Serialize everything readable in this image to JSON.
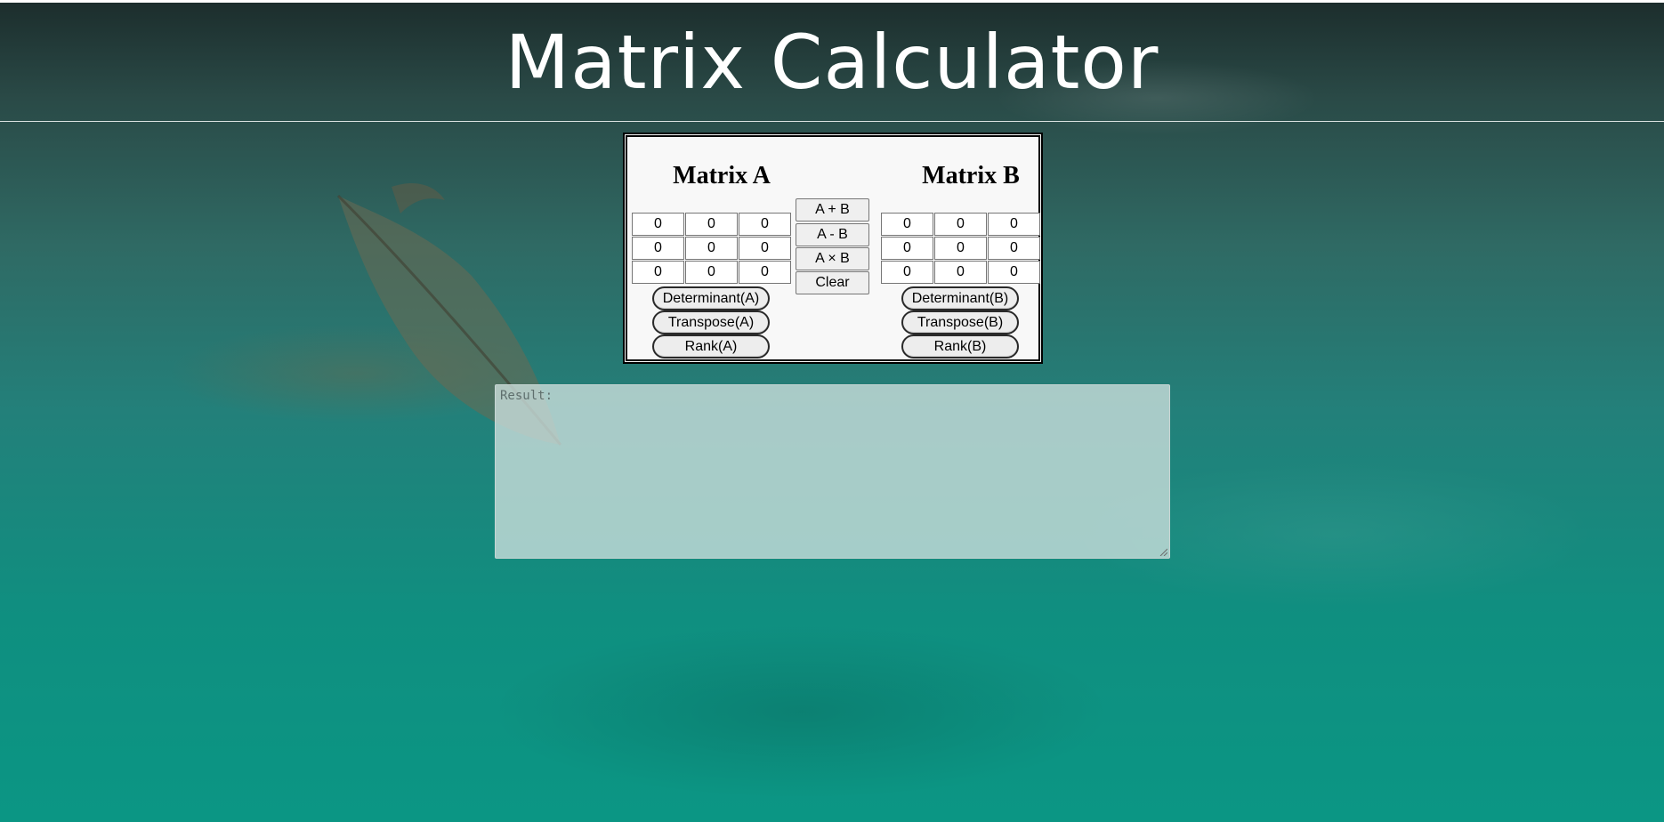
{
  "app_title": "Matrix Calculator",
  "matrix_a": {
    "title": "Matrix A",
    "cells": [
      [
        "0",
        "0",
        "0"
      ],
      [
        "0",
        "0",
        "0"
      ],
      [
        "0",
        "0",
        "0"
      ]
    ],
    "buttons": [
      "Determinant(A)",
      "Transpose(A)",
      "Rank(A)"
    ]
  },
  "matrix_b": {
    "title": "Matrix B",
    "cells": [
      [
        "0",
        "0",
        "0"
      ],
      [
        "0",
        "0",
        "0"
      ],
      [
        "0",
        "0",
        "0"
      ]
    ],
    "buttons": [
      "Determinant(B)",
      "Transpose(B)",
      "Rank(B)"
    ]
  },
  "operations": [
    "A + B",
    "A - B",
    "A × B",
    "Clear"
  ],
  "result": {
    "placeholder": "Result:",
    "value": ""
  }
}
